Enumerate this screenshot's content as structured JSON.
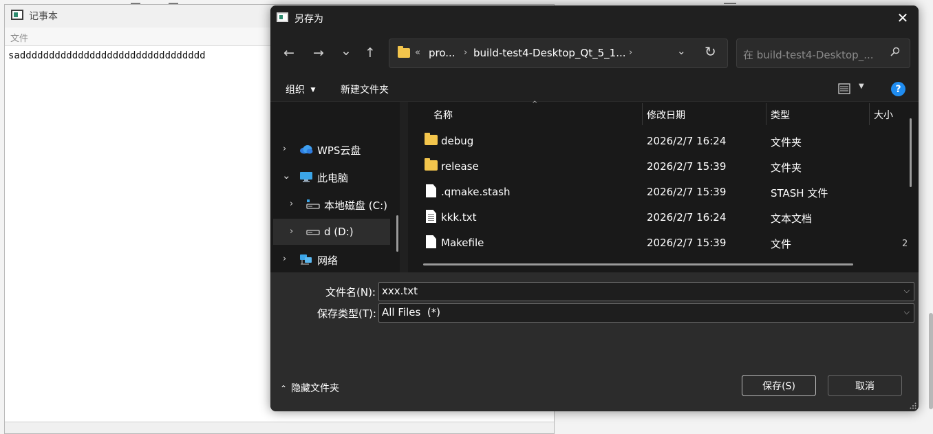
{
  "notepad": {
    "title": "记事本",
    "menu": "文件",
    "editor_text": "sadddddddddddddddddddddddddddddddd"
  },
  "dialog": {
    "title": "另存为",
    "close_glyph": "✕",
    "nav": {
      "back_glyph": "←",
      "forward_glyph": "→",
      "recent_glyph": "⌄",
      "up_glyph": "↑"
    },
    "address": {
      "overflow": "«",
      "segments": [
        "pro...",
        "build-test4-Desktop_Qt_5_1..."
      ],
      "separator": "›",
      "dropdown_glyph": "⌄",
      "refresh_glyph": "↻"
    },
    "search_placeholder": "在 build-test4-Desktop_...",
    "toolbar": {
      "organize": "组织",
      "new_folder": "新建文件夹",
      "help": "?"
    },
    "nav_pane": [
      {
        "label": "WPS云盘",
        "expander": "›",
        "icon": "cloud-icon",
        "selected": false
      },
      {
        "label": "此电脑",
        "expander": "⌄",
        "icon": "computer-icon",
        "selected": false
      },
      {
        "label": "本地磁盘 (C:)",
        "expander": "›",
        "icon": "drive-icon",
        "selected": false
      },
      {
        "label": "d (D:)",
        "expander": "›",
        "icon": "drive-icon",
        "selected": true
      },
      {
        "label": "网络",
        "expander": "›",
        "icon": "network-icon",
        "selected": false
      }
    ],
    "columns": {
      "name": "名称",
      "date": "修改日期",
      "type": "类型",
      "size": "大小"
    },
    "files": [
      {
        "name": "debug",
        "date": "2026/2/7 16:24",
        "type": "文件夹",
        "icon": "folder-icon"
      },
      {
        "name": "release",
        "date": "2026/2/7 15:39",
        "type": "文件夹",
        "icon": "folder-icon"
      },
      {
        "name": ".qmake.stash",
        "date": "2026/2/7 15:39",
        "type": "STASH 文件",
        "icon": "file-icon"
      },
      {
        "name": "kkk.txt",
        "date": "2026/2/7 16:24",
        "type": "文本文档",
        "icon": "text-file-icon"
      },
      {
        "name": "Makefile",
        "date": "2026/2/7 15:39",
        "type": "文件",
        "icon": "file-icon"
      }
    ],
    "edge_mark": "2",
    "filename_label": "文件名(N):",
    "filename_value": "xxx.txt",
    "filetype_label": "保存类型(T):",
    "filetype_value": "All Files  (*)",
    "hide_folders": "隐藏文件夹",
    "save_button": "保存(S)",
    "cancel_button": "取消",
    "colors": {
      "dialog_bg": "#202020",
      "pane_bg": "#191919",
      "bottom_bg": "#2c2c2c",
      "folder": "#f3c54c",
      "help": "#1f8cf0"
    }
  }
}
